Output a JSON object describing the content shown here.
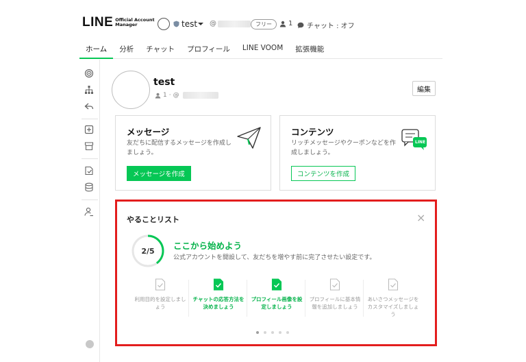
{
  "header": {
    "logo_main": "LINE",
    "logo_sub": "Official Account Manager",
    "account_name": "test",
    "account_id_prefix": "@",
    "plan_badge": "フリー",
    "friends_count": "1",
    "chat_status": "チャット : オフ"
  },
  "tabs": [
    {
      "label": "ホーム",
      "active": true
    },
    {
      "label": "分析",
      "active": false
    },
    {
      "label": "チャット",
      "active": false
    },
    {
      "label": "プロフィール",
      "active": false
    },
    {
      "label": "LINE VOOM",
      "active": false
    },
    {
      "label": "拡張機能",
      "active": false
    }
  ],
  "sidebar": {
    "icons": [
      "broadcast-icon",
      "sitemap-icon",
      "reply-icon",
      "add-message-icon",
      "shop-icon",
      "coupon-icon",
      "database-icon",
      "user-settings-icon",
      "help-icon"
    ]
  },
  "profile": {
    "name": "test",
    "friends": "1",
    "id_prefix": "@",
    "edit_label": "編集"
  },
  "cards": {
    "message": {
      "title": "メッセージ",
      "desc": "友だちに配信するメッセージを作成しましょう。",
      "button": "メッセージを作成"
    },
    "contents": {
      "title": "コンテンツ",
      "desc": "リッチメッセージやクーポンなどを作成しましょう。",
      "button": "コンテンツを作成",
      "badge": "LINE"
    }
  },
  "todo": {
    "title": "やることリスト",
    "progress_label": "2/5",
    "progress_fraction": 0.4,
    "heading": "ここから始めよう",
    "subtitle": "公式アカウントを開設して、友だちを増やす前に完了させたい設定です。",
    "steps": [
      {
        "label": "利用目的を設定しましょう",
        "done": false
      },
      {
        "label": "チャットの応答方法を決めましょう",
        "done": true
      },
      {
        "label": "プロフィール画像を設定しましょう",
        "done": true
      },
      {
        "label": "プロフィールに基本情報を追加しましょう",
        "done": false
      },
      {
        "label": "あいさつメッセージをカスタマイズしましょう",
        "done": false
      }
    ],
    "pagination_count": 5,
    "pagination_active": 0
  },
  "colors": {
    "brand_green": "#06c755",
    "highlight_red": "#e31d1d",
    "muted_gray": "#999999"
  }
}
